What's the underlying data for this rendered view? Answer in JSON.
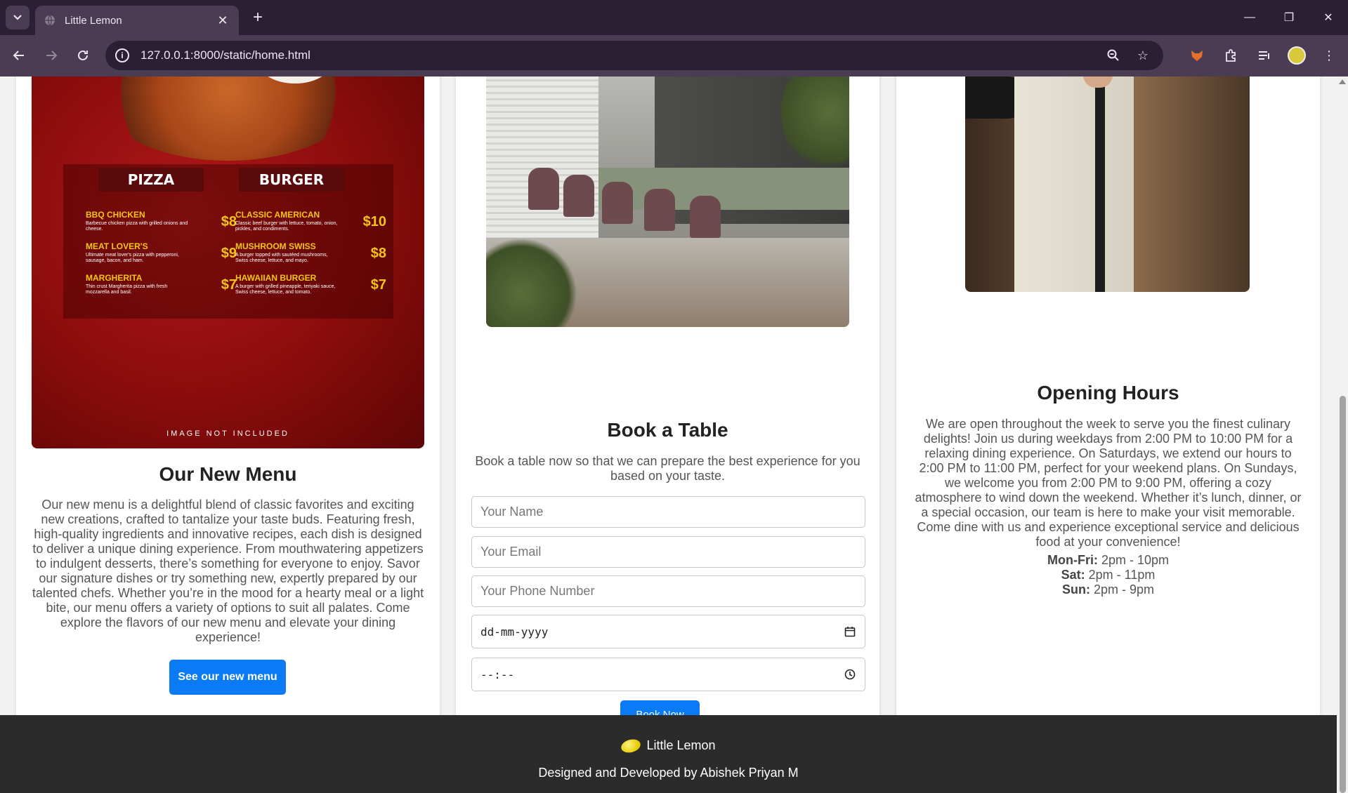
{
  "browser": {
    "tab_title": "Little Lemon",
    "url": "127.0.0.1:8000/static/home.html"
  },
  "menu_card": {
    "image": {
      "columns": [
        "PIZZA",
        "BURGER"
      ],
      "pizza_items": [
        {
          "name": "BBQ CHICKEN",
          "desc": "Barbecue chicken pizza with grilled onions and cheese.",
          "price": "$8"
        },
        {
          "name": "MEAT LOVER'S",
          "desc": "Ultimate meat lover's pizza with pepperoni, sausage, bacon, and ham.",
          "price": "$9"
        },
        {
          "name": "MARGHERITA",
          "desc": "Thin crust Margherita pizza with fresh mozzarella and basil.",
          "price": "$7"
        }
      ],
      "burger_items": [
        {
          "name": "CLASSIC AMERICAN",
          "desc": "Classic beef burger with lettuce, tomato, onion, pickles, and condiments.",
          "price": "$10"
        },
        {
          "name": "MUSHROOM SWISS",
          "desc": "A burger topped with sautéed mushrooms, Swiss cheese, lettuce, and mayo.",
          "price": "$8"
        },
        {
          "name": "HAWAIIAN BURGER",
          "desc": "A burger with grilled pineapple, teriyaki sauce, Swiss cheese, lettuce, and tomato.",
          "price": "$7"
        }
      ],
      "note": "IMAGE NOT INCLUDED"
    },
    "title": "Our New Menu",
    "description": "Our new menu is a delightful blend of classic favorites and exciting new creations, crafted to tantalize your taste buds. Featuring fresh, high-quality ingredients and innovative recipes, each dish is designed to deliver a unique dining experience. From mouthwatering appetizers to indulgent desserts, there’s something for everyone to enjoy. Savor our signature dishes or try something new, expertly prepared by our talented chefs. Whether you’re in the mood for a hearty meal or a light bite, our menu offers a variety of options to suit all palates. Come explore the flavors of our new menu and elevate your dining experience!",
    "button": "See our new menu"
  },
  "table_card": {
    "title": "Book a Table",
    "description": "Book a table now so that we can prepare the best experience for you based on your taste.",
    "fields": {
      "name_placeholder": "Your Name",
      "email_placeholder": "Your Email",
      "phone_placeholder": "Your Phone Number",
      "date_value": "dd-mm-yyyy",
      "time_value": "--:--"
    },
    "button": "Book Now"
  },
  "hours_card": {
    "title": "Opening Hours",
    "description": "We are open throughout the week to serve you the finest culinary delights! Join us during weekdays from 2:00 PM to 10:00 PM for a relaxing dining experience. On Saturdays, we extend our hours to 2:00 PM to 11:00 PM, perfect for your weekend plans. On Sundays, we welcome you from 2:00 PM to 9:00 PM, offering a cozy atmosphere to wind down the weekend. Whether it’s lunch, dinner, or a special occasion, our team is here to make your visit memorable. Come dine with us and experience exceptional service and delicious food at your convenience!",
    "schedule": [
      {
        "day": "Mon-Fri:",
        "hours": "2pm - 10pm"
      },
      {
        "day": "Sat:",
        "hours": "2pm - 11pm"
      },
      {
        "day": "Sun:",
        "hours": "2pm - 9pm"
      }
    ]
  },
  "footer": {
    "brand": "Little Lemon",
    "credit": "Designed and Developed by Abishek Priyan M"
  },
  "colors": {
    "primary": "#0b7af5",
    "chrome_dark": "#2a1f33",
    "chrome_mid": "#4a3d53",
    "footer_bg": "#2b2b2b"
  }
}
